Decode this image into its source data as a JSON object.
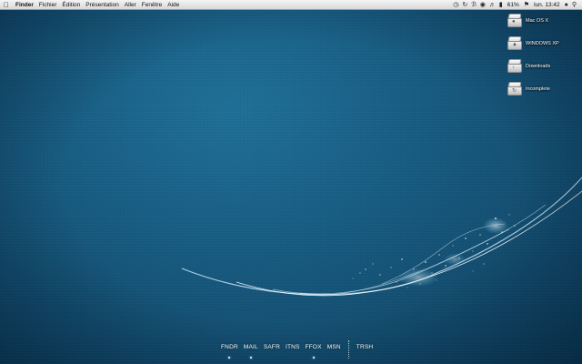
{
  "menubar": {
    "app_name": "Finder",
    "items": [
      "Fichier",
      "Édition",
      "Présentation",
      "Aller",
      "Fenêtre",
      "Aide"
    ],
    "battery": "61%",
    "clock": "lun. 13:42"
  },
  "desktop_icons": [
    {
      "label": "Mac OS X",
      "icon": "hard-drive-icon"
    },
    {
      "label": "WINDOWS XP",
      "icon": "hard-drive-icon"
    },
    {
      "label": "Downloads",
      "icon": "hard-drive-icon"
    },
    {
      "label": "Incomplete",
      "icon": "hard-drive-icon"
    }
  ],
  "dock": {
    "items": [
      {
        "label": "FNDR",
        "running": true
      },
      {
        "label": "MAIL",
        "running": true
      },
      {
        "label": "SAFR",
        "running": false
      },
      {
        "label": "ITNS",
        "running": false
      },
      {
        "label": "FFOX",
        "running": true
      },
      {
        "label": "MSN",
        "running": false
      }
    ],
    "trash": {
      "label": "TRSH",
      "running": false
    }
  },
  "colors": {
    "wallpaper": "#16587d",
    "menubar": "#e6e6e6"
  }
}
